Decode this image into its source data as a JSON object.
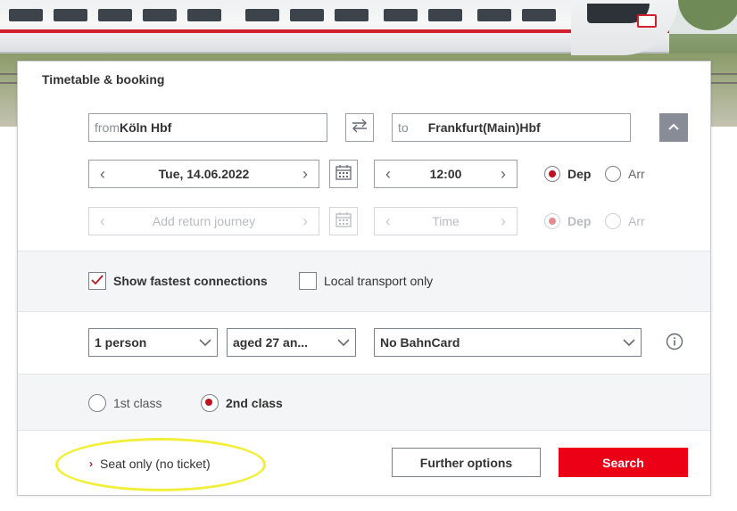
{
  "panel": {
    "title": "Timetable & booking"
  },
  "route": {
    "from_prefix": "from",
    "from_value": "Köln Hbf",
    "to_prefix": "to",
    "to_value": "Frankfurt(Main)Hbf"
  },
  "outbound": {
    "date": "Tue, 14.06.2022",
    "time": "12:00",
    "dep_label": "Dep",
    "arr_label": "Arr",
    "selected": "Dep"
  },
  "return": {
    "date_placeholder": "Add return journey",
    "time_placeholder": "Time",
    "dep_label": "Dep",
    "arr_label": "Arr"
  },
  "options": {
    "fastest_label": "Show fastest connections",
    "fastest_checked": true,
    "local_label": "Local transport only",
    "local_checked": false
  },
  "passengers": {
    "count": "1 person",
    "age": "aged 27 an...",
    "bahncard": "No BahnCard"
  },
  "class": {
    "first_label": "1st class",
    "second_label": "2nd class",
    "selected": "2nd class"
  },
  "footer": {
    "seat_only_label": "Seat only (no ticket)",
    "further_options_label": "Further options",
    "search_label": "Search"
  },
  "colors": {
    "accent_red": "#ec0016",
    "radio_red": "#c0111f",
    "highlight_yellow": "#f2ef3a"
  },
  "icons": {
    "swap": "swap-arrows-icon",
    "calendar": "calendar-icon",
    "collapse": "chevron-up-icon",
    "info": "info-icon"
  }
}
